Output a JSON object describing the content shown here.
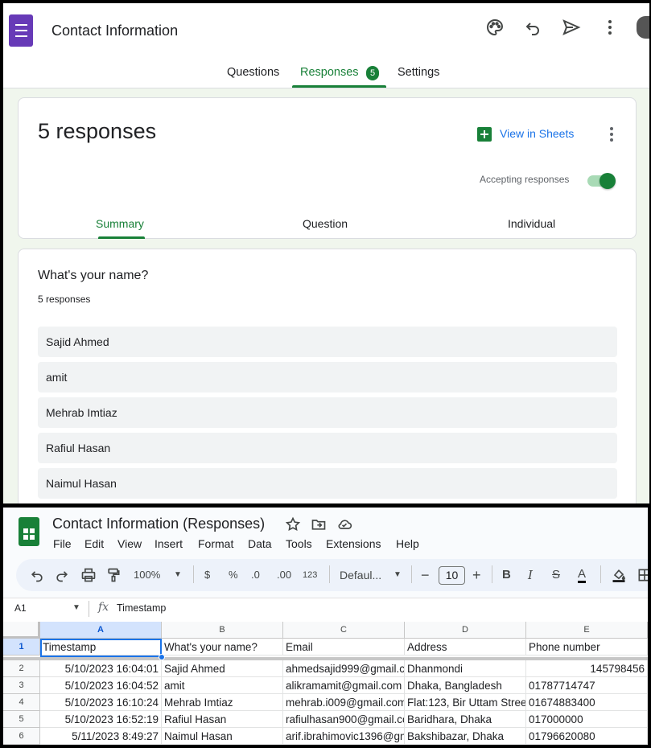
{
  "forms": {
    "title": "Contact Information",
    "tabs": [
      {
        "label": "Questions"
      },
      {
        "label": "Responses",
        "count": "5"
      },
      {
        "label": "Settings"
      }
    ],
    "summary": {
      "count_text": "5 responses",
      "view_in_sheets": "View in Sheets",
      "accepting_label": "Accepting responses",
      "accepting": true,
      "subtabs": [
        "Summary",
        "Question",
        "Individual"
      ]
    },
    "question": {
      "title": "What's your name?",
      "count_text": "5 responses",
      "answers": [
        "Sajid Ahmed",
        "amit",
        "Mehrab Imtiaz",
        "Rafiul Hasan",
        "Naimul Hasan"
      ]
    },
    "accent": "#188038"
  },
  "sheets": {
    "title": "Contact Information (Responses)",
    "menu": [
      "File",
      "Edit",
      "View",
      "Insert",
      "Format",
      "Data",
      "Tools",
      "Extensions",
      "Help"
    ],
    "toolbar": {
      "zoom": "100%",
      "currency": "$",
      "percent": "%",
      "dec_decrease": ".0",
      "dec_increase": ".00",
      "number_format": "123",
      "font": "Defaul...",
      "font_size": "10"
    },
    "name_box": "A1",
    "formula_value": "Timestamp",
    "columns": [
      "A",
      "B",
      "C",
      "D",
      "E"
    ],
    "rows": [
      {
        "num": "1",
        "cells": [
          "Timestamp",
          "What's your name?",
          "Email",
          "Address",
          "Phone number"
        ]
      },
      {
        "num": "2",
        "cells": [
          "5/10/2023 16:04:01",
          "Sajid Ahmed",
          "ahmedsajid999@gmail.c",
          "Dhanmondi",
          "145798456"
        ]
      },
      {
        "num": "3",
        "cells": [
          "5/10/2023 16:04:52",
          "amit",
          "alikramamit@gmail.com",
          "Dhaka, Bangladesh",
          "01787714747"
        ]
      },
      {
        "num": "4",
        "cells": [
          "5/10/2023 16:10:24",
          "Mehrab Imtiaz",
          "mehrab.i009@gmail.com",
          "Flat:123, Bir Uttam Stree",
          "01674883400"
        ]
      },
      {
        "num": "5",
        "cells": [
          "5/10/2023 16:52:19",
          "Rafiul Hasan",
          "rafiulhasan900@gmail.cc",
          "Baridhara, Dhaka",
          "017000000"
        ]
      },
      {
        "num": "6",
        "cells": [
          "5/11/2023 8:49:27",
          "Naimul Hasan",
          "arif.ibrahimovic1396@gn",
          "Bakshibazar, Dhaka",
          "01796620080"
        ]
      }
    ]
  }
}
